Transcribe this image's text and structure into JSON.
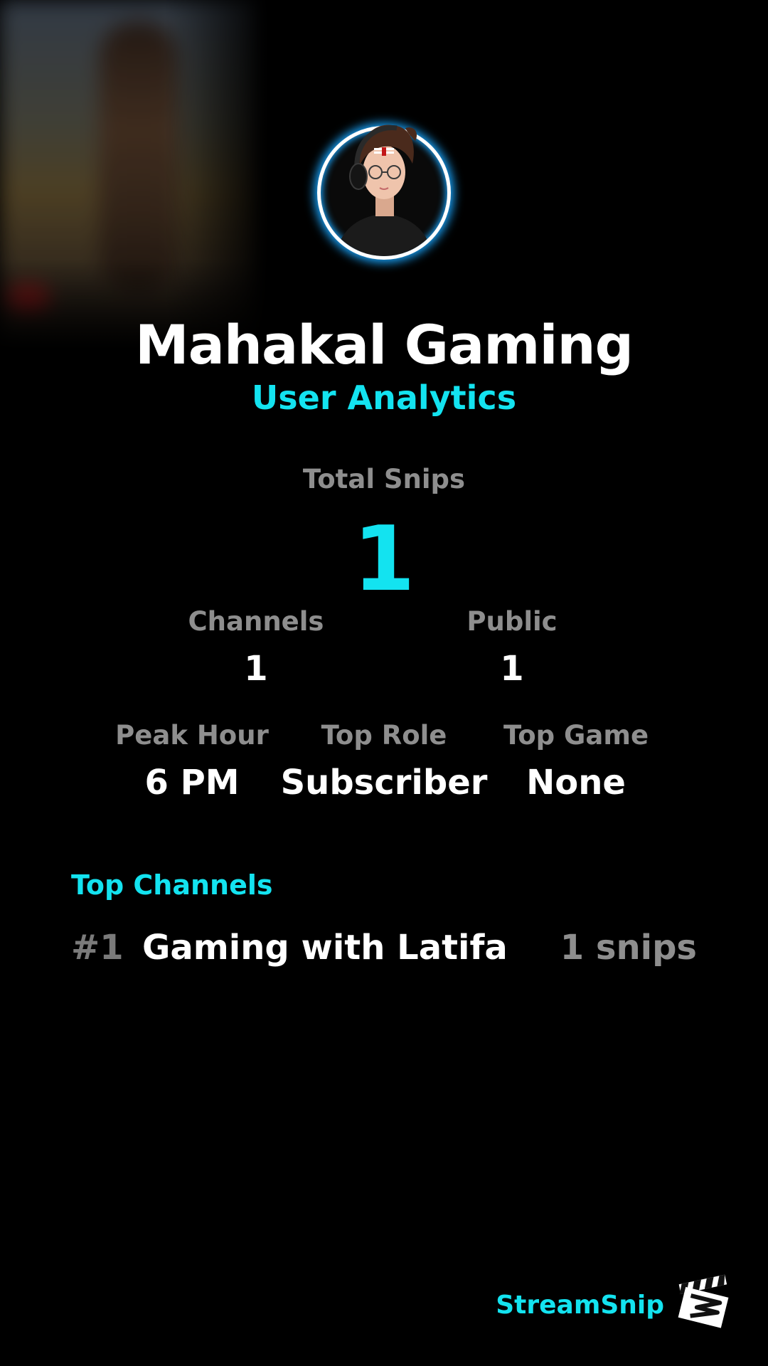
{
  "profile": {
    "name": "Mahakal Gaming",
    "subtitle": "User Analytics"
  },
  "stats": {
    "total_snips_label": "Total Snips",
    "total_snips_value": "1",
    "channels_label": "Channels",
    "channels_value": "1",
    "public_label": "Public",
    "public_value": "1",
    "peak_hour_label": "Peak Hour",
    "peak_hour_value": "6 PM",
    "top_role_label": "Top Role",
    "top_role_value": "Subscriber",
    "top_game_label": "Top Game",
    "top_game_value": "None"
  },
  "top_channels": {
    "title": "Top Channels",
    "items": [
      {
        "rank": "#1",
        "name": "Gaming with Latifa",
        "count": "1 snips"
      }
    ]
  },
  "brand": {
    "name": "StreamSnip",
    "logo_icon": "clapperboard-logo-icon"
  },
  "colors": {
    "background": "#000000",
    "accent": "#13e3f0",
    "ring_glow": "#1aa7ff",
    "label": "#8e8e8e",
    "value": "#ffffff"
  }
}
